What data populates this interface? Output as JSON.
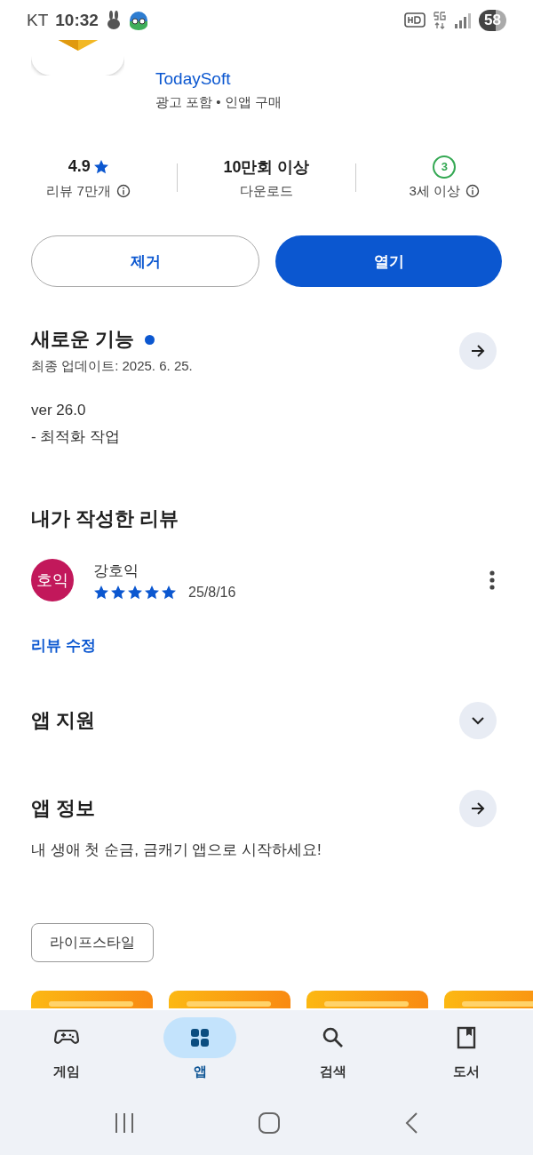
{
  "status_bar": {
    "carrier": "KT",
    "time": "10:32",
    "battery": "58"
  },
  "app": {
    "developer": "TodaySoft",
    "notes": "광고 포함 • 인앱 구매"
  },
  "stats": [
    {
      "kind": "rating",
      "value": "4.9",
      "label": "리뷰 7만개",
      "info": true
    },
    {
      "kind": "text",
      "value": "10만회 이상",
      "label": "다운로드",
      "info": false
    },
    {
      "kind": "age",
      "value": "3",
      "label": "3세 이상",
      "info": true
    }
  ],
  "buttons": [
    {
      "kind": "outline",
      "label": "제거"
    },
    {
      "kind": "filled",
      "label": "열기"
    }
  ],
  "whats_new": {
    "title": "새로운 기능",
    "new_dot": true,
    "updated": "최종 업데이트: 2025. 6. 25.",
    "notes": [
      "ver 26.0",
      "- 최적화 작업"
    ]
  },
  "my_review": {
    "title": "내가 작성한 리뷰",
    "avatar": "호익",
    "name": "강호익",
    "stars": 5,
    "date": "25/8/16",
    "edit_link": "리뷰 수정"
  },
  "support": {
    "title": "앱 지원",
    "expanded": false
  },
  "about": {
    "title": "앱 정보",
    "description": "내 생애 첫 순금, 금캐기 앱으로 시작하세요!"
  },
  "tags": [
    "라이프스타일"
  ],
  "screenshots": [
    {
      "kind": "picture"
    },
    {
      "kind": "picture"
    },
    {
      "kind": "picture"
    },
    {
      "kind": "picture"
    }
  ],
  "nav": [
    {
      "label": "게임",
      "selected": false
    },
    {
      "label": "앱",
      "selected": true
    },
    {
      "label": "검색",
      "selected": false
    },
    {
      "label": "도서",
      "selected": false
    }
  ]
}
